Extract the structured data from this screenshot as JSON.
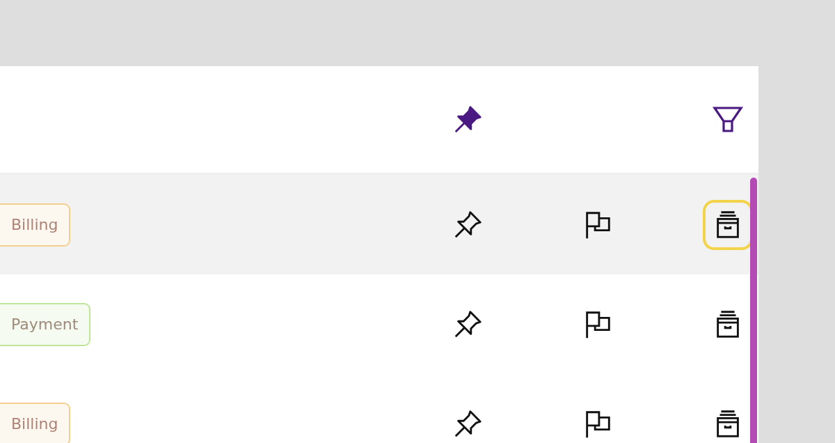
{
  "header": {
    "pin": {
      "active": true
    }
  },
  "rows": [
    {
      "tag": {
        "label": "Billing",
        "color": "#f2cf8f"
      },
      "selected": true,
      "pinned": false,
      "flagged": false,
      "archive_focused": true
    },
    {
      "tag": {
        "label": "Payment",
        "color": "#bfe59a"
      },
      "selected": false,
      "pinned": false,
      "flagged": false,
      "archive_focused": false
    },
    {
      "tag": {
        "label": "Billing",
        "color": "#f2cf8f"
      },
      "selected": false,
      "pinned": false,
      "flagged": false,
      "archive_focused": false
    }
  ]
}
